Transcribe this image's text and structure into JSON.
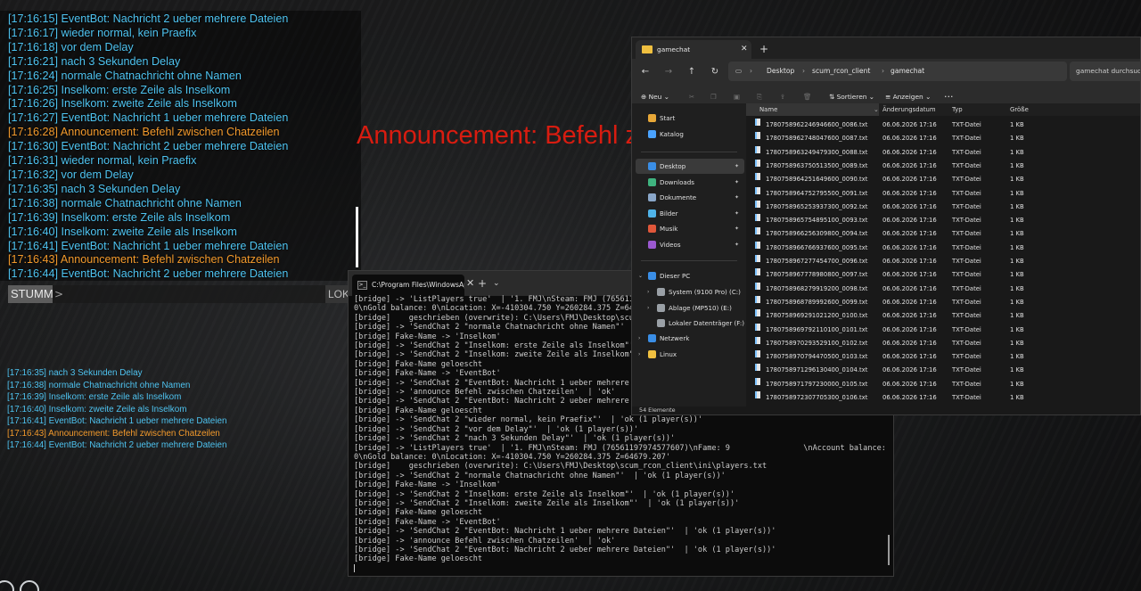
{
  "game": {
    "chat_lines": [
      {
        "text": "[17:16:15] EventBot: Nachricht 2 ueber mehrere Dateien",
        "color": "#4ec3f0"
      },
      {
        "text": "[17:16:17] wieder normal, kein Praefix",
        "color": "#4ec3f0"
      },
      {
        "text": "[17:16:18] vor dem Delay",
        "color": "#4ec3f0"
      },
      {
        "text": "[17:16:21] nach 3 Sekunden Delay",
        "color": "#4ec3f0"
      },
      {
        "text": "[17:16:24] normale Chatnachricht ohne Namen",
        "color": "#4ec3f0"
      },
      {
        "text": "[17:16:25] Inselkom: erste Zeile als Inselkom",
        "color": "#4ec3f0"
      },
      {
        "text": "[17:16:26] Inselkom: zweite Zeile als Inselkom",
        "color": "#4ec3f0"
      },
      {
        "text": "[17:16:27] EventBot: Nachricht 1 ueber mehrere Dateien",
        "color": "#4ec3f0"
      },
      {
        "text": "[17:16:28] Announcement: Befehl zwischen Chatzeilen",
        "color": "#f39a2c"
      },
      {
        "text": "[17:16:30] EventBot: Nachricht 2 ueber mehrere Dateien",
        "color": "#4ec3f0"
      },
      {
        "text": "[17:16:31] wieder normal, kein Praefix",
        "color": "#4ec3f0"
      },
      {
        "text": "[17:16:32] vor dem Delay",
        "color": "#4ec3f0"
      },
      {
        "text": "[17:16:35] nach 3 Sekunden Delay",
        "color": "#4ec3f0"
      },
      {
        "text": "[17:16:38] normale Chatnachricht ohne Namen",
        "color": "#4ec3f0"
      },
      {
        "text": "[17:16:39] Inselkom: erste Zeile als Inselkom",
        "color": "#4ec3f0"
      },
      {
        "text": "[17:16:40] Inselkom: zweite Zeile als Inselkom",
        "color": "#4ec3f0"
      },
      {
        "text": "[17:16:41] EventBot: Nachricht 1 ueber mehrere Dateien",
        "color": "#4ec3f0"
      },
      {
        "text": "[17:16:43] Announcement: Befehl zwischen Chatzeilen",
        "color": "#f39a2c"
      },
      {
        "text": "[17:16:44] EventBot: Nachricht 2 ueber mehrere Dateien",
        "color": "#4ec3f0"
      }
    ],
    "chat_channel": "STUMM",
    "chat_prompt": ">",
    "chat_scope": "LOKAL",
    "announcement": "Announcement: Befehl z",
    "feed_lines": [
      {
        "text": "[17:16:35] nach 3 Sekunden Delay",
        "color": "#4ec3f0"
      },
      {
        "text": "[17:16:38] normale Chatnachricht ohne Namen",
        "color": "#4ec3f0"
      },
      {
        "text": "[17:16:39] Inselkom: erste Zeile als Inselkom",
        "color": "#4ec3f0"
      },
      {
        "text": "[17:16:40] Inselkom: zweite Zeile als Inselkom",
        "color": "#4ec3f0"
      },
      {
        "text": "[17:16:41] EventBot: Nachricht 1 ueber mehrere Dateien",
        "color": "#4ec3f0"
      },
      {
        "text": "[17:16:43] Announcement: Befehl zwischen Chatzeilen",
        "color": "#f39a2c"
      },
      {
        "text": "[17:16:44] EventBot: Nachricht 2 ueber mehrere Dateien",
        "color": "#4ec3f0"
      }
    ]
  },
  "terminal": {
    "tab_title": "C:\\Program Files\\WindowsAp",
    "lines": [
      "[bridge] -> 'ListPlayers true'  | '1. FMJ\\nSteam: FMJ (7656119797",
      "0\\nGold balance: 0\\nLocation: X=-410304.750 Y=260284.375 Z=64679",
      "[bridge]    geschrieben (overwrite): C:\\Users\\FMJ\\Desktop\\scum_r",
      "[bridge] -> 'SendChat 2 \"normale Chatnachricht ohne Namen\"'  | '",
      "[bridge] Fake-Name -> 'Inselkom'",
      "[bridge] -> 'SendChat 2 \"Inselkom: erste Zeile als Inselkom\"'  |",
      "[bridge] -> 'SendChat 2 \"Inselkom: zweite Zeile als Inselkom\"'  |",
      "[bridge] Fake-Name geloescht",
      "[bridge] Fake-Name -> 'EventBot'",
      "[bridge] -> 'SendChat 2 \"EventBot: Nachricht 1 ueber mehrere Date",
      "[bridge] -> 'announce Befehl zwischen Chatzeilen'  | 'ok'",
      "[bridge] -> 'SendChat 2 \"EventBot: Nachricht 2 ueber mehrere Date",
      "[bridge] Fake-Name geloescht",
      "[bridge] -> 'SendChat 2 \"wieder normal, kein Praefix\"'  | 'ok (1 player(s))'",
      "[bridge] -> 'SendChat 2 \"vor dem Delay\"'  | 'ok (1 player(s))'",
      "[bridge] -> 'SendChat 2 \"nach 3 Sekunden Delay\"'  | 'ok (1 player(s))'",
      "[bridge] -> 'ListPlayers true'  | '1. FMJ\\nSteam: FMJ (76561197974577607)\\nFame: 9                \\nAccount balance:",
      "0\\nGold balance: 0\\nLocation: X=-410304.750 Y=260284.375 Z=64679.207'",
      "[bridge]    geschrieben (overwrite): C:\\Users\\FMJ\\Desktop\\scum_rcon_client\\ini\\players.txt",
      "[bridge] -> 'SendChat 2 \"normale Chatnachricht ohne Namen\"'  | 'ok (1 player(s))'",
      "[bridge] Fake-Name -> 'Inselkom'",
      "[bridge] -> 'SendChat 2 \"Inselkom: erste Zeile als Inselkom\"'  | 'ok (1 player(s))'",
      "[bridge] -> 'SendChat 2 \"Inselkom: zweite Zeile als Inselkom\"'  | 'ok (1 player(s))'",
      "[bridge] Fake-Name geloescht",
      "[bridge] Fake-Name -> 'EventBot'",
      "[bridge] -> 'SendChat 2 \"EventBot: Nachricht 1 ueber mehrere Dateien\"'  | 'ok (1 player(s))'",
      "[bridge] -> 'announce Befehl zwischen Chatzeilen'  | 'ok'",
      "[bridge] -> 'SendChat 2 \"EventBot: Nachricht 2 ueber mehrere Dateien\"'  | 'ok (1 player(s))'",
      "[bridge] Fake-Name geloescht"
    ]
  },
  "explorer": {
    "tab_title": "gamechat",
    "breadcrumb": [
      "Desktop",
      "scum_rcon_client",
      "gamechat"
    ],
    "search_placeholder": "gamechat durchsuchen",
    "toolbar": {
      "new": "Neu",
      "sort": "Sortieren",
      "view": "Anzeigen"
    },
    "sidebar": [
      {
        "label": "Start",
        "icon": "home-icon",
        "color": "#e8a838"
      },
      {
        "label": "Katalog",
        "icon": "gallery-icon",
        "color": "#4aa3ff"
      },
      {
        "label": "Desktop",
        "icon": "desktop-icon",
        "color": "#3a8ee6",
        "pinned": true,
        "selected": true
      },
      {
        "label": "Downloads",
        "icon": "download-icon",
        "color": "#3fb37f",
        "pinned": true
      },
      {
        "label": "Dokumente",
        "icon": "document-icon",
        "color": "#8aa7c9",
        "pinned": true
      },
      {
        "label": "Bilder",
        "icon": "pictures-icon",
        "color": "#4fb3e8",
        "pinned": true
      },
      {
        "label": "Musik",
        "icon": "music-icon",
        "color": "#e0573a",
        "pinned": true
      },
      {
        "label": "Videos",
        "icon": "video-icon",
        "color": "#9b59d0",
        "pinned": true
      },
      {
        "label": "Dieser PC",
        "icon": "pc-icon",
        "color": "#3a8ee6"
      },
      {
        "label": "System (9100 Pro) (C:)",
        "icon": "drive-icon",
        "color": "#9aa0a6"
      },
      {
        "label": "Ablage (MP510) (E:)",
        "icon": "drive-icon",
        "color": "#9aa0a6"
      },
      {
        "label": "Lokaler Datenträger (F:)",
        "icon": "drive-icon",
        "color": "#9aa0a6"
      },
      {
        "label": "Netzwerk",
        "icon": "network-icon",
        "color": "#3a8ee6"
      },
      {
        "label": "Linux",
        "icon": "linux-icon",
        "color": "#f0c040"
      }
    ],
    "columns": {
      "name": "Name",
      "date": "Änderungsdatum",
      "type": "Typ",
      "size": "Größe"
    },
    "files": [
      {
        "name": "1780758962246946600_0086.txt",
        "date": "06.06.2026 17:16",
        "type": "TXT-Datei",
        "size": "1 KB"
      },
      {
        "name": "1780758962748047600_0087.txt",
        "date": "06.06.2026 17:16",
        "type": "TXT-Datei",
        "size": "1 KB"
      },
      {
        "name": "1780758963249479300_0088.txt",
        "date": "06.06.2026 17:16",
        "type": "TXT-Datei",
        "size": "1 KB"
      },
      {
        "name": "1780758963750513500_0089.txt",
        "date": "06.06.2026 17:16",
        "type": "TXT-Datei",
        "size": "1 KB"
      },
      {
        "name": "1780758964251649600_0090.txt",
        "date": "06.06.2026 17:16",
        "type": "TXT-Datei",
        "size": "1 KB"
      },
      {
        "name": "1780758964752795500_0091.txt",
        "date": "06.06.2026 17:16",
        "type": "TXT-Datei",
        "size": "1 KB"
      },
      {
        "name": "1780758965253937300_0092.txt",
        "date": "06.06.2026 17:16",
        "type": "TXT-Datei",
        "size": "1 KB"
      },
      {
        "name": "1780758965754895100_0093.txt",
        "date": "06.06.2026 17:16",
        "type": "TXT-Datei",
        "size": "1 KB"
      },
      {
        "name": "1780758966256309800_0094.txt",
        "date": "06.06.2026 17:16",
        "type": "TXT-Datei",
        "size": "1 KB"
      },
      {
        "name": "1780758966766937600_0095.txt",
        "date": "06.06.2026 17:16",
        "type": "TXT-Datei",
        "size": "1 KB"
      },
      {
        "name": "1780758967277454700_0096.txt",
        "date": "06.06.2026 17:16",
        "type": "TXT-Datei",
        "size": "1 KB"
      },
      {
        "name": "1780758967778980800_0097.txt",
        "date": "06.06.2026 17:16",
        "type": "TXT-Datei",
        "size": "1 KB"
      },
      {
        "name": "1780758968279919200_0098.txt",
        "date": "06.06.2026 17:16",
        "type": "TXT-Datei",
        "size": "1 KB"
      },
      {
        "name": "1780758968789992600_0099.txt",
        "date": "06.06.2026 17:16",
        "type": "TXT-Datei",
        "size": "1 KB"
      },
      {
        "name": "1780758969291021200_0100.txt",
        "date": "06.06.2026 17:16",
        "type": "TXT-Datei",
        "size": "1 KB"
      },
      {
        "name": "1780758969792110100_0101.txt",
        "date": "06.06.2026 17:16",
        "type": "TXT-Datei",
        "size": "1 KB"
      },
      {
        "name": "1780758970293529100_0102.txt",
        "date": "06.06.2026 17:16",
        "type": "TXT-Datei",
        "size": "1 KB"
      },
      {
        "name": "1780758970794470500_0103.txt",
        "date": "06.06.2026 17:16",
        "type": "TXT-Datei",
        "size": "1 KB"
      },
      {
        "name": "1780758971296130400_0104.txt",
        "date": "06.06.2026 17:16",
        "type": "TXT-Datei",
        "size": "1 KB"
      },
      {
        "name": "1780758971797230000_0105.txt",
        "date": "06.06.2026 17:16",
        "type": "TXT-Datei",
        "size": "1 KB"
      },
      {
        "name": "1780758972307705300_0106.txt",
        "date": "06.06.2026 17:16",
        "type": "TXT-Datei",
        "size": "1 KB"
      }
    ],
    "status": "54 Elemente"
  }
}
